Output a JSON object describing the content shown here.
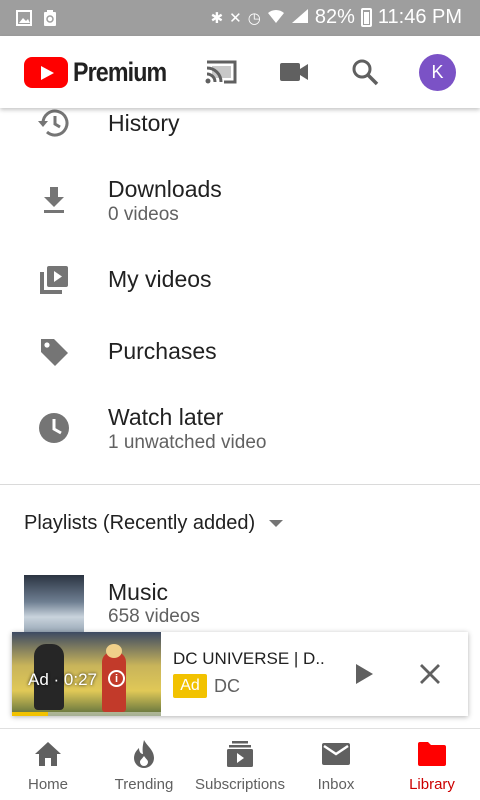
{
  "status_bar": {
    "battery": "82%",
    "time": "11:46 PM"
  },
  "app_bar": {
    "logo_text": "Premium",
    "avatar_letter": "K",
    "brand_color": "#ff0000",
    "avatar_color": "#7b52c6",
    "icons": [
      "cast-icon",
      "camera-icon",
      "search-icon"
    ]
  },
  "library_items": [
    {
      "title": "History",
      "icon": "history-icon"
    },
    {
      "title": "Downloads",
      "subtitle": "0 videos",
      "icon": "download-icon"
    },
    {
      "title": "My videos",
      "icon": "my-videos-icon"
    },
    {
      "title": "Purchases",
      "icon": "tag-icon"
    },
    {
      "title": "Watch later",
      "subtitle": "1 unwatched video",
      "icon": "clock-icon"
    }
  ],
  "playlists": {
    "header": "Playlists (Recently added)",
    "items": [
      {
        "title": "Music",
        "subtitle": "658 videos"
      }
    ]
  },
  "mini_player": {
    "title": "DC UNIVERSE | D..",
    "ad_badge": "Ad",
    "channel": "DC",
    "ad_time": "Ad · 0:27",
    "progress": 0.24,
    "ad_color": "#f2c200"
  },
  "bottom_nav": [
    {
      "label": "Home",
      "icon": "home-icon",
      "active": false
    },
    {
      "label": "Trending",
      "icon": "trending-icon",
      "active": false
    },
    {
      "label": "Subscriptions",
      "icon": "subscriptions-icon",
      "active": false
    },
    {
      "label": "Inbox",
      "icon": "inbox-icon",
      "active": false
    },
    {
      "label": "Library",
      "icon": "library-icon",
      "active": true
    }
  ],
  "active_color": "#cc0000"
}
